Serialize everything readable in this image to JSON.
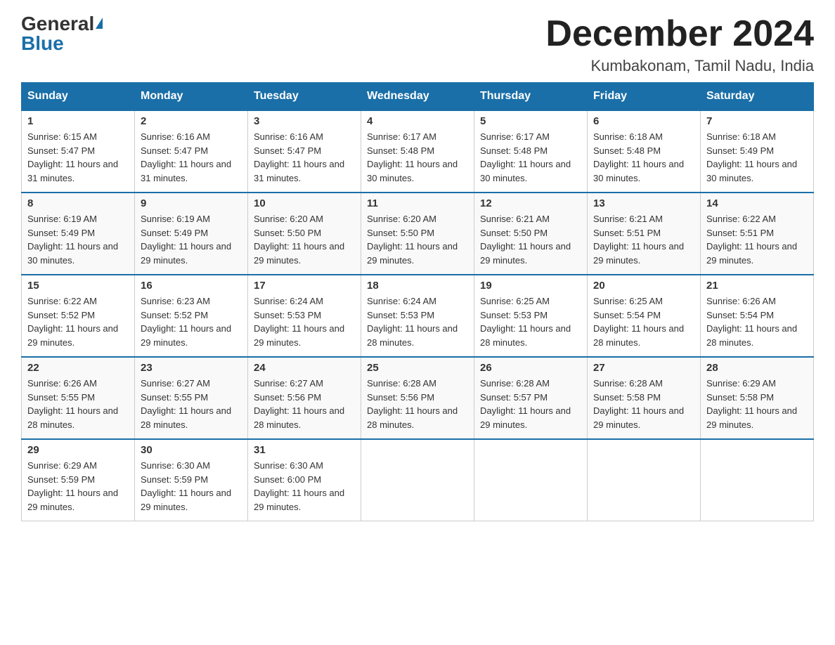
{
  "logo": {
    "general": "General",
    "blue": "Blue"
  },
  "title": "December 2024",
  "subtitle": "Kumbakonam, Tamil Nadu, India",
  "days_of_week": [
    "Sunday",
    "Monday",
    "Tuesday",
    "Wednesday",
    "Thursday",
    "Friday",
    "Saturday"
  ],
  "weeks": [
    [
      {
        "day": "1",
        "sunrise": "6:15 AM",
        "sunset": "5:47 PM",
        "daylight": "11 hours and 31 minutes."
      },
      {
        "day": "2",
        "sunrise": "6:16 AM",
        "sunset": "5:47 PM",
        "daylight": "11 hours and 31 minutes."
      },
      {
        "day": "3",
        "sunrise": "6:16 AM",
        "sunset": "5:47 PM",
        "daylight": "11 hours and 31 minutes."
      },
      {
        "day": "4",
        "sunrise": "6:17 AM",
        "sunset": "5:48 PM",
        "daylight": "11 hours and 30 minutes."
      },
      {
        "day": "5",
        "sunrise": "6:17 AM",
        "sunset": "5:48 PM",
        "daylight": "11 hours and 30 minutes."
      },
      {
        "day": "6",
        "sunrise": "6:18 AM",
        "sunset": "5:48 PM",
        "daylight": "11 hours and 30 minutes."
      },
      {
        "day": "7",
        "sunrise": "6:18 AM",
        "sunset": "5:49 PM",
        "daylight": "11 hours and 30 minutes."
      }
    ],
    [
      {
        "day": "8",
        "sunrise": "6:19 AM",
        "sunset": "5:49 PM",
        "daylight": "11 hours and 30 minutes."
      },
      {
        "day": "9",
        "sunrise": "6:19 AM",
        "sunset": "5:49 PM",
        "daylight": "11 hours and 29 minutes."
      },
      {
        "day": "10",
        "sunrise": "6:20 AM",
        "sunset": "5:50 PM",
        "daylight": "11 hours and 29 minutes."
      },
      {
        "day": "11",
        "sunrise": "6:20 AM",
        "sunset": "5:50 PM",
        "daylight": "11 hours and 29 minutes."
      },
      {
        "day": "12",
        "sunrise": "6:21 AM",
        "sunset": "5:50 PM",
        "daylight": "11 hours and 29 minutes."
      },
      {
        "day": "13",
        "sunrise": "6:21 AM",
        "sunset": "5:51 PM",
        "daylight": "11 hours and 29 minutes."
      },
      {
        "day": "14",
        "sunrise": "6:22 AM",
        "sunset": "5:51 PM",
        "daylight": "11 hours and 29 minutes."
      }
    ],
    [
      {
        "day": "15",
        "sunrise": "6:22 AM",
        "sunset": "5:52 PM",
        "daylight": "11 hours and 29 minutes."
      },
      {
        "day": "16",
        "sunrise": "6:23 AM",
        "sunset": "5:52 PM",
        "daylight": "11 hours and 29 minutes."
      },
      {
        "day": "17",
        "sunrise": "6:24 AM",
        "sunset": "5:53 PM",
        "daylight": "11 hours and 29 minutes."
      },
      {
        "day": "18",
        "sunrise": "6:24 AM",
        "sunset": "5:53 PM",
        "daylight": "11 hours and 28 minutes."
      },
      {
        "day": "19",
        "sunrise": "6:25 AM",
        "sunset": "5:53 PM",
        "daylight": "11 hours and 28 minutes."
      },
      {
        "day": "20",
        "sunrise": "6:25 AM",
        "sunset": "5:54 PM",
        "daylight": "11 hours and 28 minutes."
      },
      {
        "day": "21",
        "sunrise": "6:26 AM",
        "sunset": "5:54 PM",
        "daylight": "11 hours and 28 minutes."
      }
    ],
    [
      {
        "day": "22",
        "sunrise": "6:26 AM",
        "sunset": "5:55 PM",
        "daylight": "11 hours and 28 minutes."
      },
      {
        "day": "23",
        "sunrise": "6:27 AM",
        "sunset": "5:55 PM",
        "daylight": "11 hours and 28 minutes."
      },
      {
        "day": "24",
        "sunrise": "6:27 AM",
        "sunset": "5:56 PM",
        "daylight": "11 hours and 28 minutes."
      },
      {
        "day": "25",
        "sunrise": "6:28 AM",
        "sunset": "5:56 PM",
        "daylight": "11 hours and 28 minutes."
      },
      {
        "day": "26",
        "sunrise": "6:28 AM",
        "sunset": "5:57 PM",
        "daylight": "11 hours and 29 minutes."
      },
      {
        "day": "27",
        "sunrise": "6:28 AM",
        "sunset": "5:58 PM",
        "daylight": "11 hours and 29 minutes."
      },
      {
        "day": "28",
        "sunrise": "6:29 AM",
        "sunset": "5:58 PM",
        "daylight": "11 hours and 29 minutes."
      }
    ],
    [
      {
        "day": "29",
        "sunrise": "6:29 AM",
        "sunset": "5:59 PM",
        "daylight": "11 hours and 29 minutes."
      },
      {
        "day": "30",
        "sunrise": "6:30 AM",
        "sunset": "5:59 PM",
        "daylight": "11 hours and 29 minutes."
      },
      {
        "day": "31",
        "sunrise": "6:30 AM",
        "sunset": "6:00 PM",
        "daylight": "11 hours and 29 minutes."
      },
      null,
      null,
      null,
      null
    ]
  ],
  "labels": {
    "sunrise": "Sunrise: ",
    "sunset": "Sunset: ",
    "daylight": "Daylight: "
  }
}
